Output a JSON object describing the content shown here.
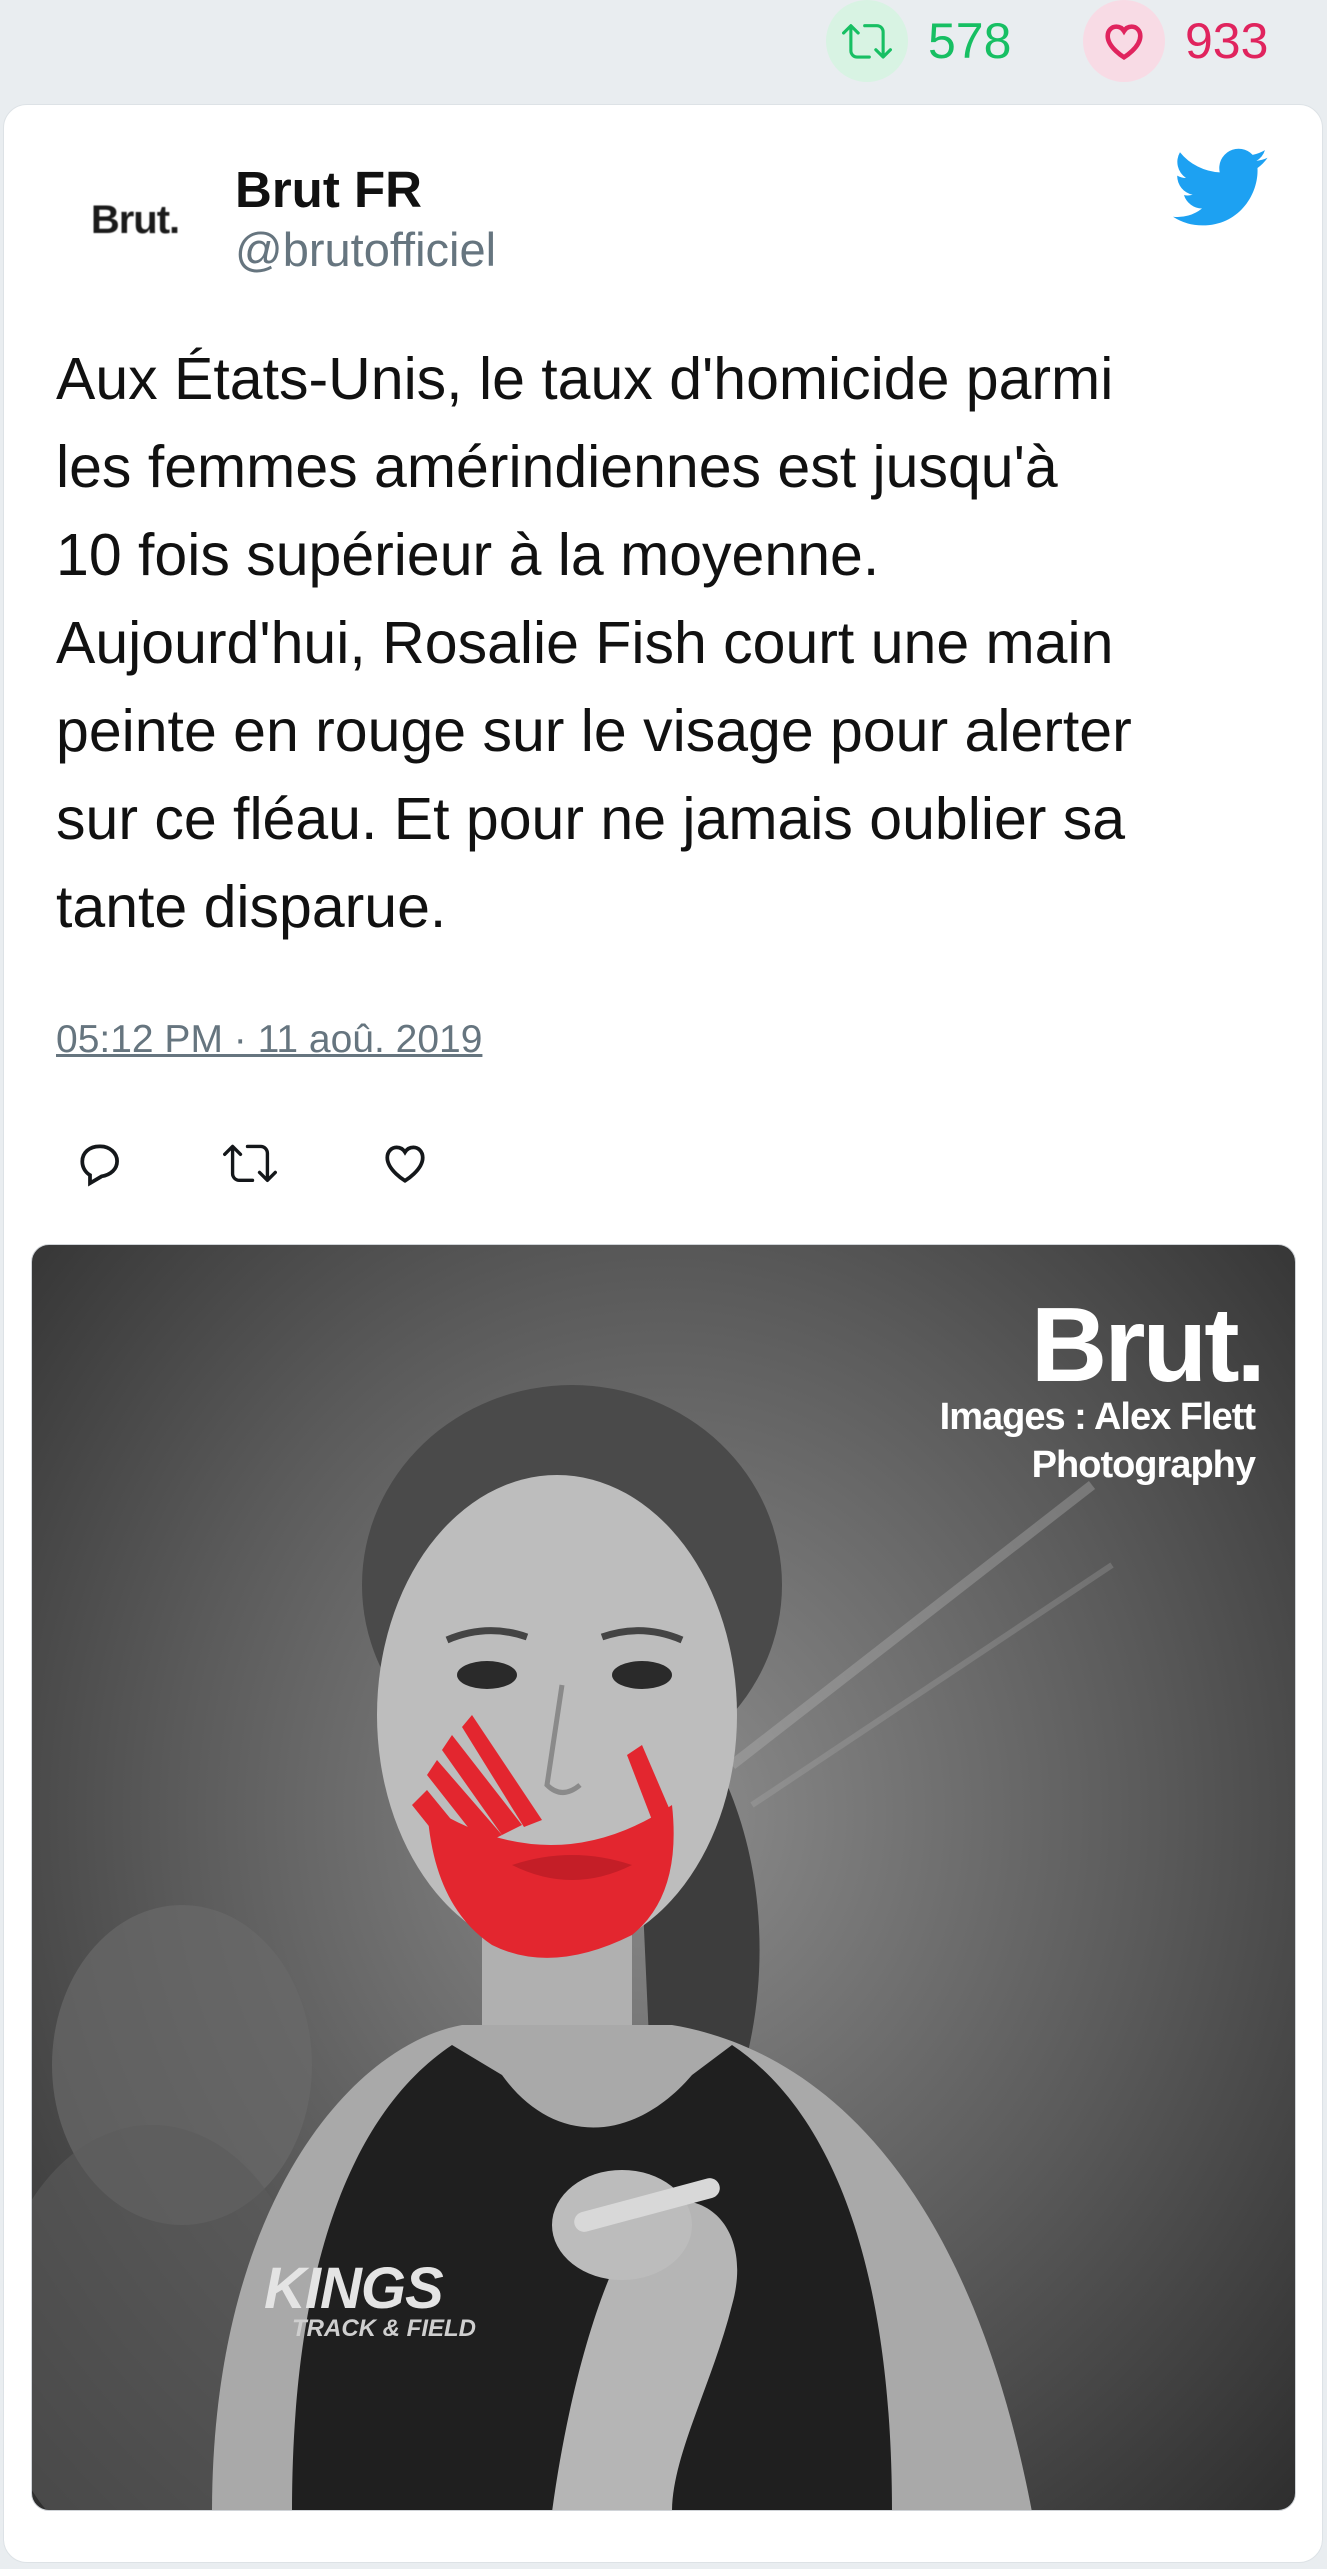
{
  "stats": {
    "retweet_count": "578",
    "like_count": "933"
  },
  "author": {
    "avatar_text": "Brut.",
    "name": "Brut FR",
    "handle": "@brutofficiel"
  },
  "tweet": {
    "text": "Aux États-Unis, le taux d'homicide parmi\nles femmes amérindiennes est jusqu'à\n10 fois supérieur à la moyenne.\nAujourd'hui, Rosalie Fish court une main\npeinte en rouge sur le visage pour alerter\nsur ce fléau. Et pour ne jamais oublier sa\ntante disparue.",
    "timestamp": "05:12 PM · 11 aoû. 2019"
  },
  "media": {
    "brand": "Brut.",
    "credit": "Images : Alex Flett\nPhotography",
    "shirt_text": "KINGS",
    "shirt_sub": "TRACK & FIELD"
  },
  "icons": {
    "retweet": "retweet-icon",
    "like": "heart-icon",
    "reply": "reply-icon",
    "platform": "twitter-bird-icon"
  },
  "colors": {
    "retweet_green": "#17bf63",
    "like_red": "#e0245e",
    "twitter_blue": "#1da1f2",
    "muted_text": "#66757f",
    "hand_paint": "#e3262f"
  }
}
